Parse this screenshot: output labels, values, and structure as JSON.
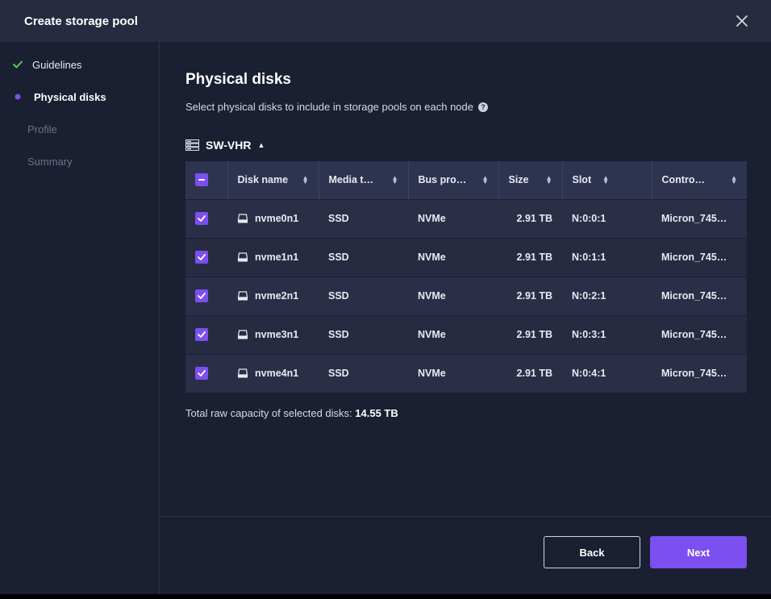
{
  "dialog": {
    "title": "Create storage pool"
  },
  "sidebar": {
    "steps": [
      {
        "label": "Guidelines",
        "state": "done"
      },
      {
        "label": "Physical disks",
        "state": "active"
      },
      {
        "label": "Profile",
        "state": "pending"
      },
      {
        "label": "Summary",
        "state": "pending"
      }
    ]
  },
  "main": {
    "title": "Physical disks",
    "subtitle": "Select physical disks to include in storage pools on each node",
    "node_name": "SW-VHR",
    "columns": [
      "Disk name",
      "Media t…",
      "Bus pro…",
      "Size",
      "Slot",
      "Contro…"
    ],
    "disks": [
      {
        "name": "nvme0n1",
        "media": "SSD",
        "bus": "NVMe",
        "size": "2.91 TB",
        "slot": "N:0:0:1",
        "controller": "Micron_745…",
        "selected": true
      },
      {
        "name": "nvme1n1",
        "media": "SSD",
        "bus": "NVMe",
        "size": "2.91 TB",
        "slot": "N:0:1:1",
        "controller": "Micron_745…",
        "selected": true
      },
      {
        "name": "nvme2n1",
        "media": "SSD",
        "bus": "NVMe",
        "size": "2.91 TB",
        "slot": "N:0:2:1",
        "controller": "Micron_745…",
        "selected": true
      },
      {
        "name": "nvme3n1",
        "media": "SSD",
        "bus": "NVMe",
        "size": "2.91 TB",
        "slot": "N:0:3:1",
        "controller": "Micron_745…",
        "selected": true
      },
      {
        "name": "nvme4n1",
        "media": "SSD",
        "bus": "NVMe",
        "size": "2.91 TB",
        "slot": "N:0:4:1",
        "controller": "Micron_745…",
        "selected": true
      }
    ],
    "total_label": "Total raw capacity of selected disks:",
    "total_value": "14.55 TB"
  },
  "footer": {
    "back_label": "Back",
    "next_label": "Next"
  },
  "colors": {
    "accent": "#7b4ff0",
    "success": "#5cc85c",
    "background": "#1b1f32",
    "header": "#262b40"
  },
  "icons": {
    "close": "close-icon",
    "check": "check-icon",
    "server": "server-icon",
    "disk": "disk-icon",
    "help": "help-icon"
  }
}
